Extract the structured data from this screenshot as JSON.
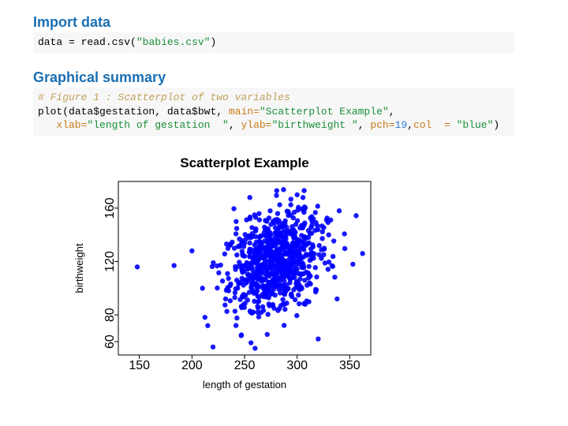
{
  "sections": {
    "import": {
      "heading": "Import data",
      "code_plain": "data = read.csv(\"babies.csv\")",
      "code_tokens": [
        {
          "t": "data ",
          "c": "tok-assign"
        },
        {
          "t": "= ",
          "c": "tok-assign"
        },
        {
          "t": "read.csv",
          "c": "tok-fn"
        },
        {
          "t": "(",
          "c": ""
        },
        {
          "t": "\"babies.csv\"",
          "c": "tok-str"
        },
        {
          "t": ")",
          "c": ""
        }
      ]
    },
    "graphical": {
      "heading": "Graphical summary",
      "code_plain": "# Figure 1 : Scatterplot of two variables\nplot(data$gestation, data$bwt, main=\"Scatterplot Example\",\n   xlab=\"length of gestation  \", ylab=\"birthweight \", pch=19,col  = \"blue\")",
      "code_tokens": [
        {
          "t": "# Figure 1 : Scatterplot of two variables",
          "c": "tok-comment"
        },
        {
          "t": "\n",
          "c": ""
        },
        {
          "t": "plot",
          "c": "tok-fn"
        },
        {
          "t": "(data$gestation, data$bwt, ",
          "c": ""
        },
        {
          "t": "main=",
          "c": "tok-arg"
        },
        {
          "t": "\"Scatterplot Example\"",
          "c": "tok-str"
        },
        {
          "t": ",",
          "c": ""
        },
        {
          "t": "\n   ",
          "c": ""
        },
        {
          "t": "xlab=",
          "c": "tok-arg"
        },
        {
          "t": "\"length of gestation  \"",
          "c": "tok-str"
        },
        {
          "t": ", ",
          "c": ""
        },
        {
          "t": "ylab=",
          "c": "tok-arg"
        },
        {
          "t": "\"birthweight \"",
          "c": "tok-str"
        },
        {
          "t": ", ",
          "c": ""
        },
        {
          "t": "pch=",
          "c": "tok-arg"
        },
        {
          "t": "19",
          "c": "tok-num"
        },
        {
          "t": ",",
          "c": ""
        },
        {
          "t": "col  = ",
          "c": "tok-arg"
        },
        {
          "t": "\"blue\"",
          "c": "tok-str"
        },
        {
          "t": ")",
          "c": ""
        }
      ]
    }
  },
  "chart_data": {
    "type": "scatter",
    "title": "Scatterplot Example",
    "xlabel": "length of gestation",
    "ylabel": "birthweight",
    "xlim": [
      130,
      370
    ],
    "ylim": [
      50,
      180
    ],
    "xticks": [
      150,
      200,
      250,
      300,
      350
    ],
    "yticks": [
      60,
      80,
      120,
      160
    ],
    "point_color": "#0000ff",
    "series": [
      {
        "name": "babies",
        "cluster": {
          "cx": 280,
          "cy": 120,
          "sdx": 22,
          "sdy": 18,
          "n": 800
        },
        "outliers": [
          [
            148,
            116
          ],
          [
            183,
            117
          ],
          [
            215,
            72
          ],
          [
            220,
            56
          ],
          [
            247,
            65
          ],
          [
            232,
            92
          ],
          [
            210,
            100
          ],
          [
            340,
            158
          ],
          [
            353,
            118
          ],
          [
            338,
            92
          ],
          [
            320,
            62
          ],
          [
            300,
            170
          ],
          [
            260,
            55
          ],
          [
            255,
            168
          ],
          [
            200,
            128
          ],
          [
            242,
            150
          ],
          [
            330,
            140
          ]
        ]
      }
    ]
  }
}
